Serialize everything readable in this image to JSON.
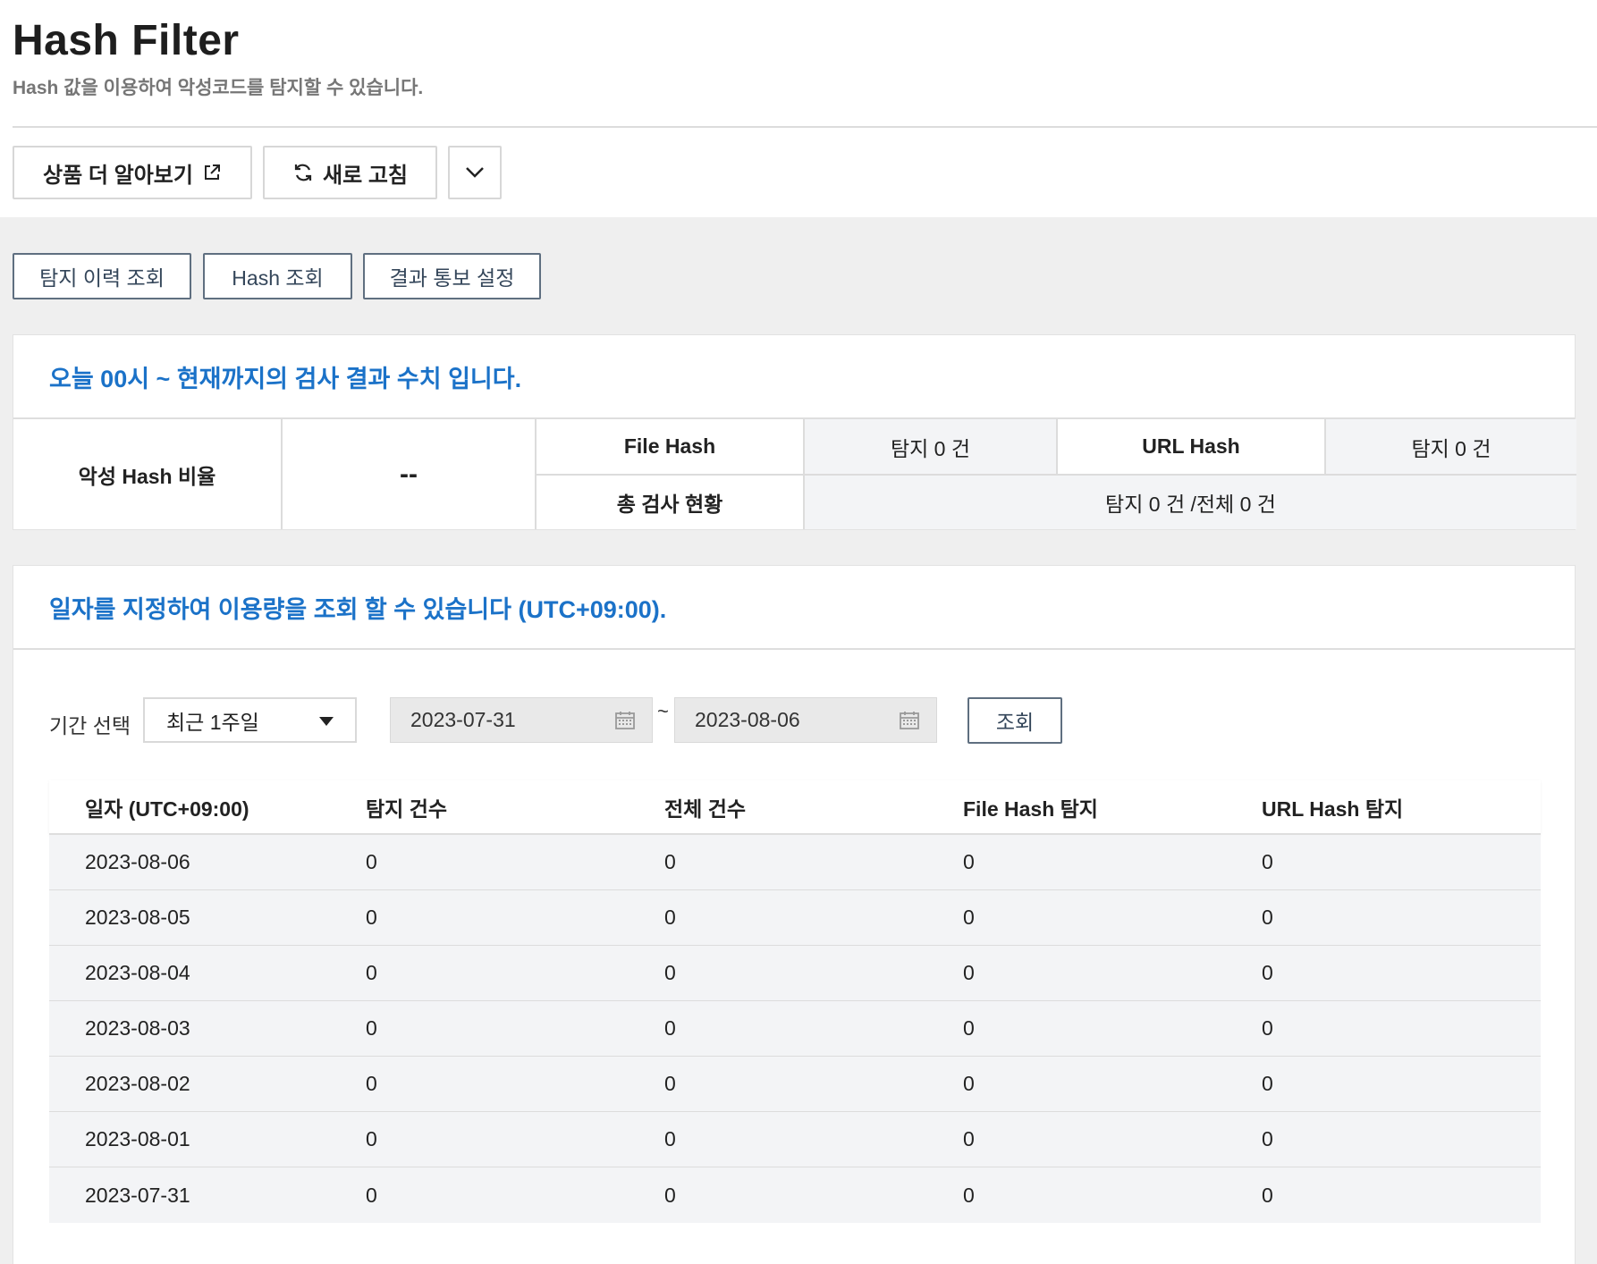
{
  "header": {
    "title": "Hash Filter",
    "subtitle": "Hash 값을 이용하여 악성코드를 탐지할 수 있습니다.",
    "learn_more_label": "상품 더 알아보기",
    "refresh_label": "새로 고침"
  },
  "tabs": [
    {
      "label": "탐지 이력 조회"
    },
    {
      "label": "Hash 조회"
    },
    {
      "label": "결과 통보 설정"
    }
  ],
  "today_panel": {
    "heading": "오늘 00시 ~ 현재까지의 검사 결과 수치 입니다.",
    "ratio_label": "악성 Hash 비율",
    "ratio_value": "--",
    "file_hash_label": "File Hash",
    "file_hash_value": "탐지  0  건",
    "url_hash_label": "URL Hash",
    "url_hash_value": "탐지  0  건",
    "total_label": "총 검사 현황",
    "total_value": "탐지  0  건 /전체  0  건"
  },
  "usage_panel": {
    "heading": "일자를 지정하여 이용량을 조회 할 수 있습니다 (UTC+09:00).",
    "period_label": "기간 선택",
    "period_selected": "최근 1주일",
    "start_date": "2023-07-31",
    "end_date": "2023-08-06",
    "tilde": "~",
    "query_label": "조회",
    "columns": [
      "일자 (UTC+09:00)",
      "탐지 건수",
      "전체 건수",
      "File Hash 탐지",
      "URL Hash 탐지"
    ],
    "rows": [
      [
        "2023-08-06",
        "0",
        "0",
        "0",
        "0"
      ],
      [
        "2023-08-05",
        "0",
        "0",
        "0",
        "0"
      ],
      [
        "2023-08-04",
        "0",
        "0",
        "0",
        "0"
      ],
      [
        "2023-08-03",
        "0",
        "0",
        "0",
        "0"
      ],
      [
        "2023-08-02",
        "0",
        "0",
        "0",
        "0"
      ],
      [
        "2023-08-01",
        "0",
        "0",
        "0",
        "0"
      ],
      [
        "2023-07-31",
        "0",
        "0",
        "0",
        "0"
      ]
    ]
  },
  "colors": {
    "accent_blue": "#1b72c8",
    "tab_border": "#5f6f80",
    "page_background": "#efefef"
  }
}
